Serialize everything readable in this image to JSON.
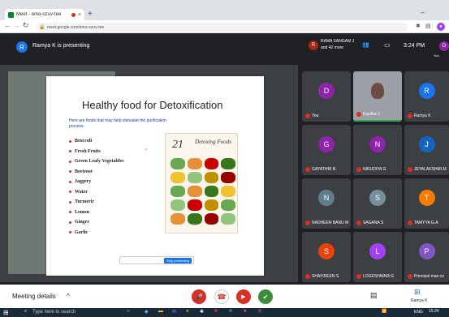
{
  "browser": {
    "tab_title": "Meet - emo-ozuv-tee",
    "url": "meet.google.com/emo-ozuv-tee",
    "new_tab": "+",
    "minimize": "–"
  },
  "presenting": {
    "avatar_letter": "R",
    "text": "Ramya K is presenting",
    "host_avatar": "R",
    "host_name": "RAMA SANGAM J",
    "host_sub": "and 42 more",
    "time": "3:24 PM",
    "you_label": "You"
  },
  "slide": {
    "title": "Healthy food for Detoxification",
    "intro": "Here are foods that may help stimulate the purification process:",
    "items": [
      "Broccoli",
      "Fresh Fruits",
      "Green Leafy Vegetables",
      "Beetroot",
      "Jaggery",
      "Water",
      "Turmeric",
      "Lemon",
      "Ginger",
      "Garlic"
    ],
    "image_number": "21",
    "image_title": "Detoxing Foods",
    "stop_button": "Stop presenting"
  },
  "participants": [
    {
      "letter": "D",
      "name": "You",
      "color": "#8e24aa"
    },
    {
      "letter": "",
      "name": "Kavitha J",
      "color": "#5f6368"
    },
    {
      "letter": "R",
      "name": "Ramya K",
      "color": "#1a73e8"
    },
    {
      "letter": "G",
      "name": "GAYATHRI B",
      "color": "#8e24aa"
    },
    {
      "letter": "N",
      "name": "NIRUDIYA G",
      "color": "#8e24aa"
    },
    {
      "letter": "J",
      "name": "JEYALAKSHMI M",
      "color": "#1565c0"
    },
    {
      "letter": "N",
      "name": "NADHEEN BANU M",
      "color": "#607d8b"
    },
    {
      "letter": "S",
      "name": "SAGANA S",
      "color": "#78909c"
    },
    {
      "letter": "T",
      "name": "TAMYYA G.A",
      "color": "#f57c00"
    },
    {
      "letter": "S",
      "name": "SHAYIREEN S",
      "color": "#e8430c"
    },
    {
      "letter": "L",
      "name": "LOGESHWARI E",
      "color": "#a142f4"
    },
    {
      "letter": "P",
      "name": "Principal man.co",
      "color": "#7e57c2"
    }
  ],
  "meet_bar": {
    "details": "Meeting details",
    "chevron": "^",
    "presenter_label": "Ramya K"
  },
  "taskbar": {
    "search": "Type here to search",
    "lang": "ENG",
    "time": "15:24"
  }
}
